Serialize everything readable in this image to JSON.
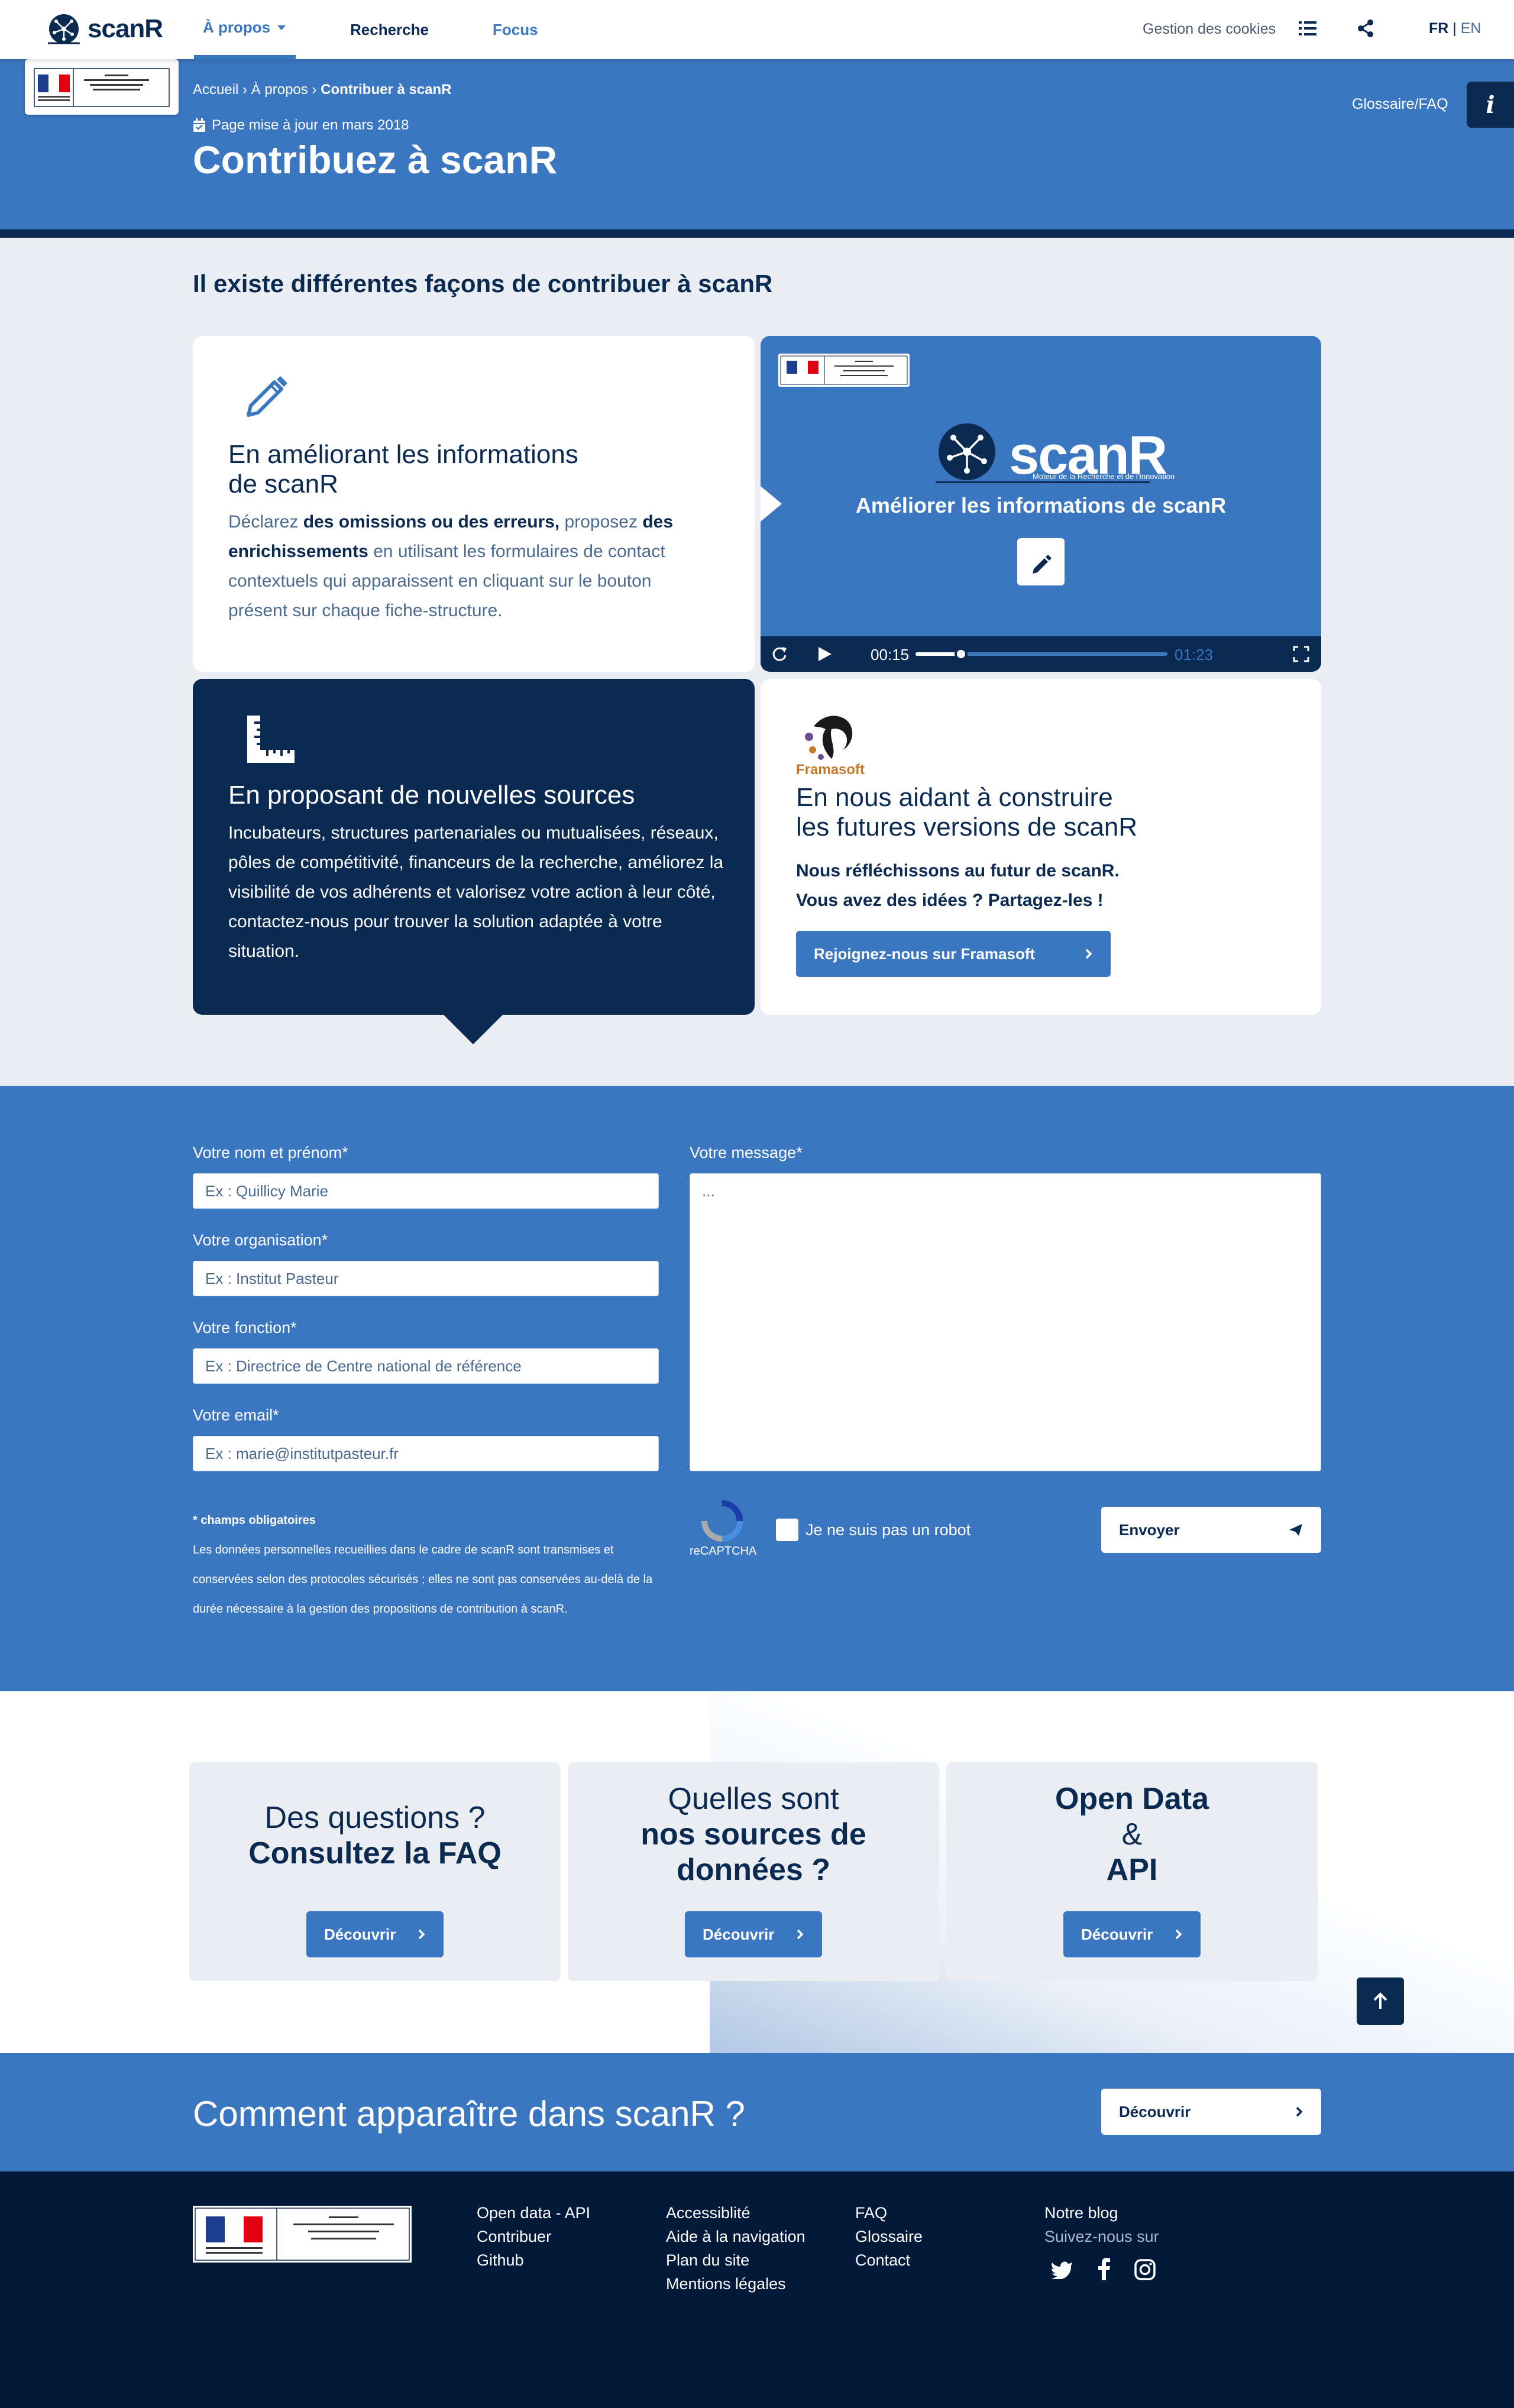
{
  "header": {
    "logo": "scanR",
    "nav": [
      "À propos",
      "Recherche",
      "Focus"
    ],
    "cookies": "Gestion des cookies",
    "lang_fr": "FR",
    "lang_sep": "|",
    "lang_en": "EN"
  },
  "breadcrumb": {
    "home": "Accueil",
    "sep1": "›",
    "about": "À propos",
    "sep2": "›",
    "current": "Contribuer à scanR"
  },
  "hero": {
    "updated": "Page mise à jour en mars 2018",
    "title": "Contribuez à scanR",
    "glossary": "Glossaire/FAQ",
    "info_btn": "i"
  },
  "section1": {
    "title": "Il existe différentes façons de contribuer à scanR",
    "card1": {
      "title_line1": "En améliorant les informations",
      "title_line2": "de scanR",
      "t1": "Déclarez ",
      "b1": "des omissions ou des erreurs,",
      "t2": " proposez ",
      "b2": "des enrichissements",
      "t3": " en utilisant les formulaires de contact contextuels qui apparaissent en cliquant sur le bouton présent sur chaque fiche-structure."
    },
    "video": {
      "logo": "scanR",
      "tagline": "Moteur de la Recherche et de l'Innovation",
      "caption": "Améliorer les informations de scanR",
      "time_current": "00:15",
      "time_total": "01:23",
      "progress": 0.18
    },
    "card3": {
      "title": "En proposant de nouvelles sources",
      "text": "Incubateurs, structures partenariales ou mutualisées, réseaux, pôles de compétitivité, financeurs de la recherche, améliorez la visibilité de vos adhérents et valorisez votre action à leur côté, contactez-nous pour trouver la solution adaptée à votre situation."
    },
    "card4": {
      "logo_text": "Framasoft",
      "title_line1": "En nous aidant à construire",
      "title_line2": "les futures versions de scanR",
      "bold1": "Nous réfléchissons au futur de scanR.",
      "bold2": "Vous avez des idées ? Partagez-les !",
      "button": "Rejoignez-nous sur Framasoft"
    }
  },
  "form": {
    "name_label": "Votre nom et prénom*",
    "name_placeholder": "Ex : Quillicy Marie",
    "org_label": "Votre organisation*",
    "org_placeholder": "Ex : Institut Pasteur",
    "role_label": "Votre fonction*",
    "role_placeholder": "Ex : Directrice de Centre national de référence",
    "email_label": "Votre email*",
    "email_placeholder": "Ex : marie@institutpasteur.fr",
    "message_label": "Votre message*",
    "message_placeholder": "...",
    "required_note": "* champs obligatoires",
    "privacy": "Les données personnelles recueillies dans le cadre de scanR sont transmises et conservées selon des protocoles sécurisés ; elles ne sont pas conservées au-delà de la durée nécessaire à la gestion des propositions de contribution à scanR.",
    "recaptcha": "reCAPTCHA",
    "robot": "Je ne suis pas un robot",
    "submit": "Envoyer"
  },
  "faq": {
    "card1_line1": "Des questions ?",
    "card1_line2": "Consultez la FAQ",
    "card2_line1": "Quelles sont",
    "card2_line2": "nos sources de",
    "card2_line3": "données ?",
    "card3_line1": "Open Data",
    "card3_line2": "&",
    "card3_line3": "API",
    "button": "Découvrir"
  },
  "banner": {
    "title": "Comment apparaître dans scanR ?",
    "button": "Découvrir"
  },
  "footer": {
    "col1": [
      "Open data - API",
      "Contribuer",
      "Github"
    ],
    "col2": [
      "Accessiblité",
      "Aide à la navigation",
      "Plan du site",
      "Mentions légales"
    ],
    "col3": [
      "FAQ",
      "Glossaire",
      "Contact"
    ],
    "blog": "Notre blog",
    "follow": "Suivez-nous sur"
  },
  "colors": {
    "primary": "#3b76c0",
    "navy": "#0a2a52",
    "dark_footer": "#03193a",
    "light_bg": "#eaedf1"
  }
}
